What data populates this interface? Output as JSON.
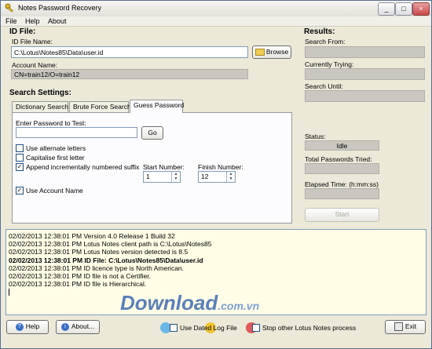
{
  "window": {
    "title": "Notes Password Recovery",
    "minimize": "_",
    "maximize": "□",
    "close": "×"
  },
  "menu": {
    "file": "File",
    "help": "Help",
    "about": "About"
  },
  "id_file": {
    "heading": "ID File:",
    "file_label": "ID File Name:",
    "file_value": "C:\\Lotus\\Notes85\\Data\\user.id",
    "browse": "Browse",
    "account_label": "Account Name:",
    "account_value": "CN=train12/O=train12"
  },
  "search_settings": {
    "heading": "Search Settings:",
    "tabs": [
      "Dictionary Search",
      "Brute Force Search",
      "Guess Password"
    ],
    "enter_label": "Enter Password to Test:",
    "password_value": "",
    "go": "Go",
    "opt_alternate": "Use alternate letters",
    "opt_capitalise": "Capitalise first letter",
    "opt_append": "Append incrementally numbered suffix",
    "opt_account": "Use Account Name",
    "checks": {
      "alternate": false,
      "capitalise": false,
      "append": true,
      "account": true
    },
    "start_label": "Start Number:",
    "start_value": "1",
    "finish_label": "Finish Number:",
    "finish_value": "12"
  },
  "results": {
    "heading": "Results:",
    "search_from": "Search From:",
    "currently_trying": "Currently Trying:",
    "search_until": "Search Until:",
    "status_label": "Status:",
    "status_value": "Idle",
    "total_label": "Total Passwords Tried:",
    "elapsed_label": "Elapsed Time: (h:mm:ss)",
    "start": "Start"
  },
  "log": [
    {
      "text": "02/02/2013 12:38:01 PM Version 4.0 Release 1 Build 32",
      "bold": false
    },
    {
      "text": "02/02/2013 12:38:01 PM Lotus Notes client path is C:\\Lotus\\Notes85",
      "bold": false
    },
    {
      "text": "02/02/2013 12:38:01 PM Lotus Notes version detected is 8.5",
      "bold": false
    },
    {
      "text": "02/02/2013 12:38:01 PM ID File: C:\\Lotus\\Notes85\\Data\\user.id",
      "bold": true
    },
    {
      "text": "02/02/2013 12:38:01 PM ID licence type is North American.",
      "bold": false
    },
    {
      "text": "02/02/2013 12:38:01 PM ID file is not a Certifier.",
      "bold": false
    },
    {
      "text": "02/02/2013 12:38:01 PM ID file is Hierarchical.",
      "bold": false
    }
  ],
  "watermark": {
    "main": "Download",
    "sub": ".com.vn"
  },
  "footer": {
    "help": "Help",
    "about": "About...",
    "dated_log": "Use Dated Log File",
    "stop_other": "Stop other Lotus Notes process",
    "exit": "Exit"
  },
  "colors": {
    "bubble_blue": "#6ab7e8",
    "bubble_yellow": "#f2c230",
    "bubble_red": "#e05a5a"
  }
}
